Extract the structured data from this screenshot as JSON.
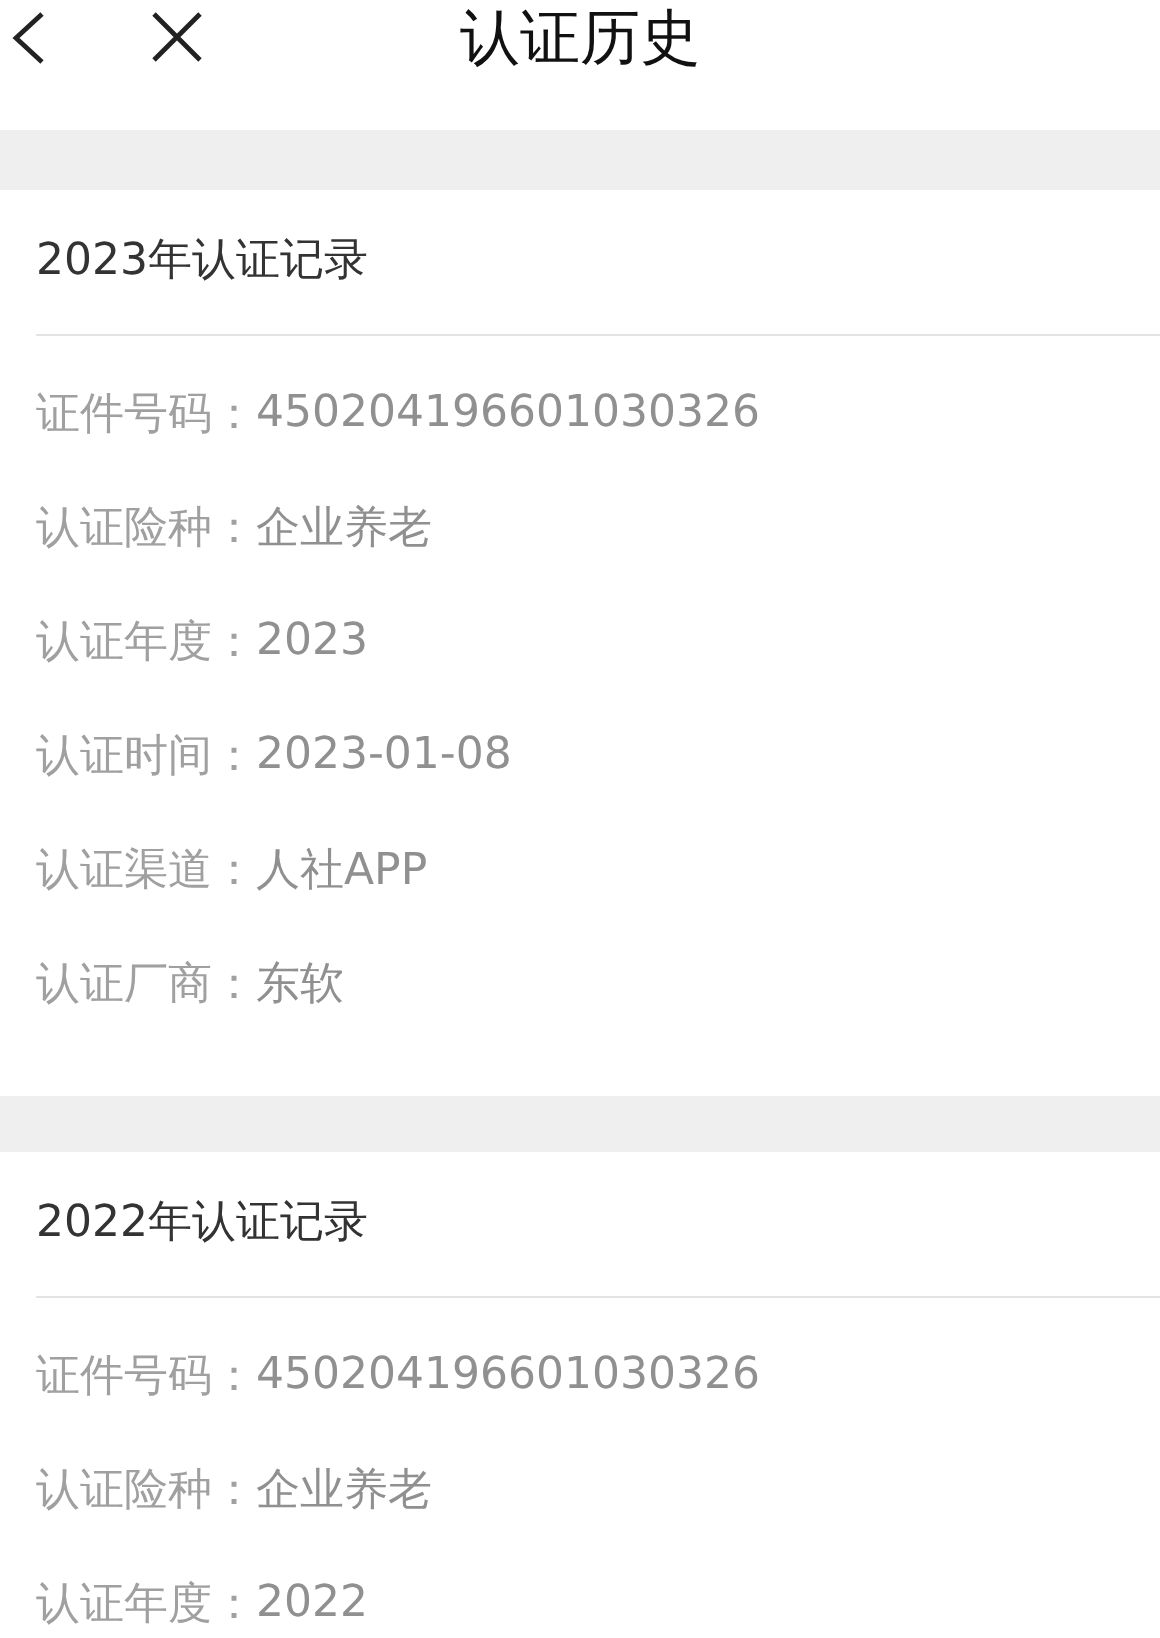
{
  "header": {
    "title": "认证历史"
  },
  "records": [
    {
      "title": "2023年认证记录",
      "fields": [
        {
          "label": "证件号码：",
          "value": "450204196601030326"
        },
        {
          "label": "认证险种：",
          "value": "企业养老"
        },
        {
          "label": "认证年度：",
          "value": "2023"
        },
        {
          "label": "认证时间：",
          "value": "2023-01-08"
        },
        {
          "label": "认证渠道：",
          "value": "人社APP"
        },
        {
          "label": "认证厂商：",
          "value": "东软"
        }
      ]
    },
    {
      "title": "2022年认证记录",
      "fields": [
        {
          "label": "证件号码：",
          "value": "450204196601030326"
        },
        {
          "label": "认证险种：",
          "value": "企业养老"
        },
        {
          "label": "认证年度：",
          "value": "2022"
        }
      ]
    }
  ]
}
